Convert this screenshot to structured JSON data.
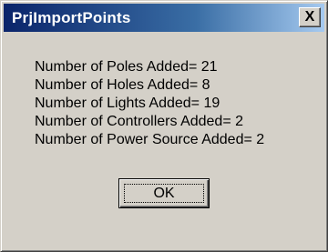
{
  "window": {
    "title": "PrjImportPoints",
    "close_glyph": "X"
  },
  "messages": [
    "Number of Poles Added= 21",
    "Number of Holes Added= 8",
    "Number of Lights Added= 19",
    "Number of Controllers Added= 2",
    "Number of Power Source Added= 2"
  ],
  "buttons": {
    "ok_label": "OK"
  },
  "colors": {
    "titlebar_start": "#0a246a",
    "titlebar_end": "#a6caf0",
    "dialog_bg": "#d4d0c8"
  }
}
